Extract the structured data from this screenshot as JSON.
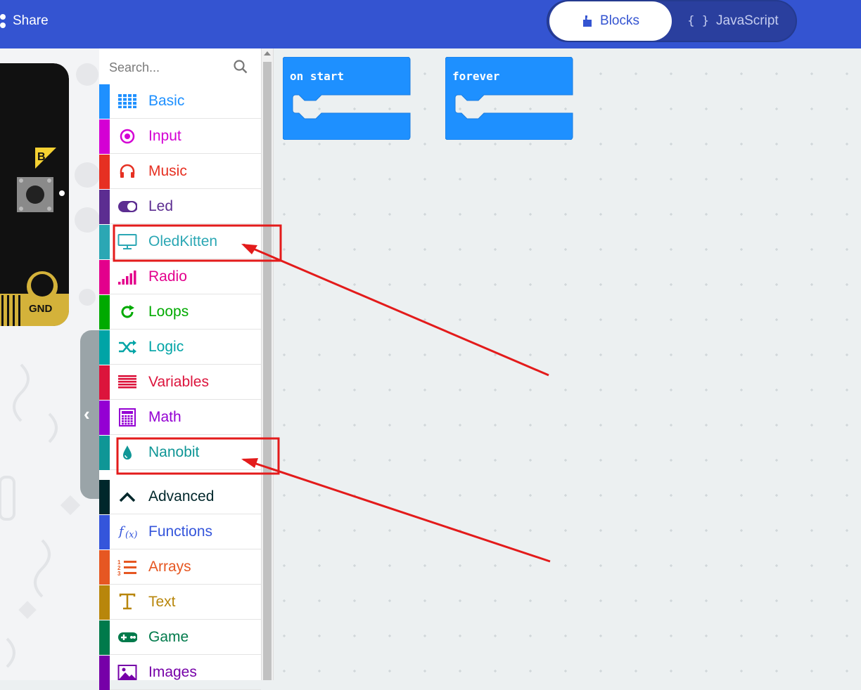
{
  "header": {
    "share_label": "Share",
    "tabs": [
      {
        "label": "Blocks",
        "icon": "puzzle-icon",
        "active": true
      },
      {
        "label": "JavaScript",
        "icon": "braces-icon",
        "active": false
      }
    ],
    "braces": "{ }",
    "background": "#3454d1"
  },
  "simulator": {
    "button_label": "B",
    "pin_label": "GND"
  },
  "toolbox": {
    "search_placeholder": "Search...",
    "categories": [
      {
        "label": "Basic",
        "color": "#1e90ff",
        "icon": "grid-icon"
      },
      {
        "label": "Input",
        "color": "#d400d4",
        "icon": "target-icon"
      },
      {
        "label": "Music",
        "color": "#e63022",
        "icon": "headphones-icon"
      },
      {
        "label": "Led",
        "color": "#5c2d91",
        "icon": "toggle-icon"
      },
      {
        "label": "OledKitten",
        "color": "#2ba7b4",
        "icon": "monitor-icon"
      },
      {
        "label": "Radio",
        "color": "#e3008c",
        "icon": "signal-icon"
      },
      {
        "label": "Loops",
        "color": "#00aa00",
        "icon": "refresh-icon"
      },
      {
        "label": "Logic",
        "color": "#00a4a6",
        "icon": "shuffle-icon"
      },
      {
        "label": "Variables",
        "color": "#dc143c",
        "icon": "list-icon"
      },
      {
        "label": "Math",
        "color": "#9400d3",
        "icon": "calculator-icon"
      },
      {
        "label": "Nanobit",
        "color": "#0f9696",
        "icon": "drop-icon"
      }
    ],
    "advanced": [
      {
        "label": "Advanced",
        "color": "#00272b",
        "icon": "chevron-up-icon"
      },
      {
        "label": "Functions",
        "color": "#3455db",
        "icon": "function-icon"
      },
      {
        "label": "Arrays",
        "color": "#e65722",
        "icon": "numbered-list-icon"
      },
      {
        "label": "Text",
        "color": "#b8860b",
        "icon": "text-icon"
      },
      {
        "label": "Game",
        "color": "#007a4b",
        "icon": "gamepad-icon"
      },
      {
        "label": "Images",
        "color": "#7600a8",
        "icon": "image-icon"
      }
    ]
  },
  "workspace": {
    "blocks": [
      {
        "label": "on start",
        "color": "#1e90ff"
      },
      {
        "label": "forever",
        "color": "#1e90ff"
      }
    ]
  },
  "annotations": {
    "color": "#e31b1b",
    "highlighted": [
      "OledKitten",
      "Nanobit"
    ]
  }
}
